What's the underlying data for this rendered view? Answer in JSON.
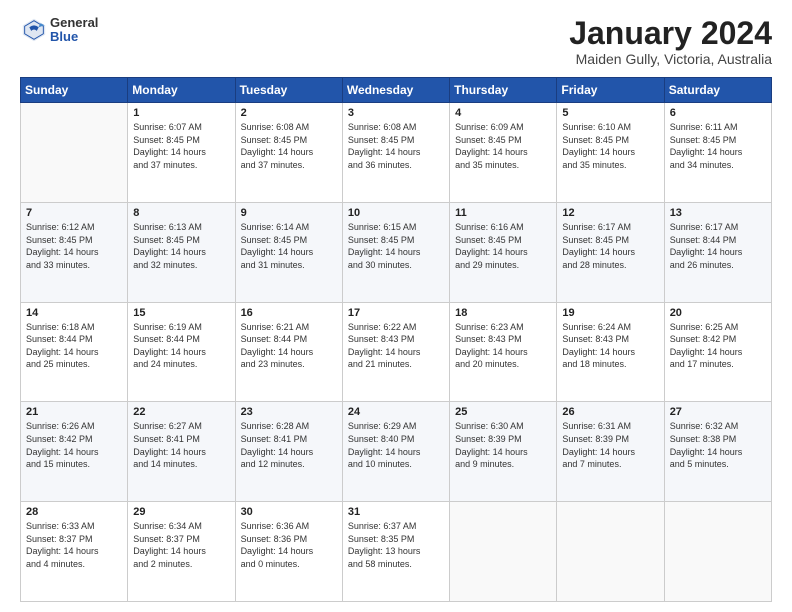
{
  "logo": {
    "general": "General",
    "blue": "Blue"
  },
  "header": {
    "title": "January 2024",
    "subtitle": "Maiden Gully, Victoria, Australia"
  },
  "days_of_week": [
    "Sunday",
    "Monday",
    "Tuesday",
    "Wednesday",
    "Thursday",
    "Friday",
    "Saturday"
  ],
  "weeks": [
    [
      {
        "day": "",
        "info": ""
      },
      {
        "day": "1",
        "info": "Sunrise: 6:07 AM\nSunset: 8:45 PM\nDaylight: 14 hours\nand 37 minutes."
      },
      {
        "day": "2",
        "info": "Sunrise: 6:08 AM\nSunset: 8:45 PM\nDaylight: 14 hours\nand 37 minutes."
      },
      {
        "day": "3",
        "info": "Sunrise: 6:08 AM\nSunset: 8:45 PM\nDaylight: 14 hours\nand 36 minutes."
      },
      {
        "day": "4",
        "info": "Sunrise: 6:09 AM\nSunset: 8:45 PM\nDaylight: 14 hours\nand 35 minutes."
      },
      {
        "day": "5",
        "info": "Sunrise: 6:10 AM\nSunset: 8:45 PM\nDaylight: 14 hours\nand 35 minutes."
      },
      {
        "day": "6",
        "info": "Sunrise: 6:11 AM\nSunset: 8:45 PM\nDaylight: 14 hours\nand 34 minutes."
      }
    ],
    [
      {
        "day": "7",
        "info": "Sunrise: 6:12 AM\nSunset: 8:45 PM\nDaylight: 14 hours\nand 33 minutes."
      },
      {
        "day": "8",
        "info": "Sunrise: 6:13 AM\nSunset: 8:45 PM\nDaylight: 14 hours\nand 32 minutes."
      },
      {
        "day": "9",
        "info": "Sunrise: 6:14 AM\nSunset: 8:45 PM\nDaylight: 14 hours\nand 31 minutes."
      },
      {
        "day": "10",
        "info": "Sunrise: 6:15 AM\nSunset: 8:45 PM\nDaylight: 14 hours\nand 30 minutes."
      },
      {
        "day": "11",
        "info": "Sunrise: 6:16 AM\nSunset: 8:45 PM\nDaylight: 14 hours\nand 29 minutes."
      },
      {
        "day": "12",
        "info": "Sunrise: 6:17 AM\nSunset: 8:45 PM\nDaylight: 14 hours\nand 28 minutes."
      },
      {
        "day": "13",
        "info": "Sunrise: 6:17 AM\nSunset: 8:44 PM\nDaylight: 14 hours\nand 26 minutes."
      }
    ],
    [
      {
        "day": "14",
        "info": "Sunrise: 6:18 AM\nSunset: 8:44 PM\nDaylight: 14 hours\nand 25 minutes."
      },
      {
        "day": "15",
        "info": "Sunrise: 6:19 AM\nSunset: 8:44 PM\nDaylight: 14 hours\nand 24 minutes."
      },
      {
        "day": "16",
        "info": "Sunrise: 6:21 AM\nSunset: 8:44 PM\nDaylight: 14 hours\nand 23 minutes."
      },
      {
        "day": "17",
        "info": "Sunrise: 6:22 AM\nSunset: 8:43 PM\nDaylight: 14 hours\nand 21 minutes."
      },
      {
        "day": "18",
        "info": "Sunrise: 6:23 AM\nSunset: 8:43 PM\nDaylight: 14 hours\nand 20 minutes."
      },
      {
        "day": "19",
        "info": "Sunrise: 6:24 AM\nSunset: 8:43 PM\nDaylight: 14 hours\nand 18 minutes."
      },
      {
        "day": "20",
        "info": "Sunrise: 6:25 AM\nSunset: 8:42 PM\nDaylight: 14 hours\nand 17 minutes."
      }
    ],
    [
      {
        "day": "21",
        "info": "Sunrise: 6:26 AM\nSunset: 8:42 PM\nDaylight: 14 hours\nand 15 minutes."
      },
      {
        "day": "22",
        "info": "Sunrise: 6:27 AM\nSunset: 8:41 PM\nDaylight: 14 hours\nand 14 minutes."
      },
      {
        "day": "23",
        "info": "Sunrise: 6:28 AM\nSunset: 8:41 PM\nDaylight: 14 hours\nand 12 minutes."
      },
      {
        "day": "24",
        "info": "Sunrise: 6:29 AM\nSunset: 8:40 PM\nDaylight: 14 hours\nand 10 minutes."
      },
      {
        "day": "25",
        "info": "Sunrise: 6:30 AM\nSunset: 8:39 PM\nDaylight: 14 hours\nand 9 minutes."
      },
      {
        "day": "26",
        "info": "Sunrise: 6:31 AM\nSunset: 8:39 PM\nDaylight: 14 hours\nand 7 minutes."
      },
      {
        "day": "27",
        "info": "Sunrise: 6:32 AM\nSunset: 8:38 PM\nDaylight: 14 hours\nand 5 minutes."
      }
    ],
    [
      {
        "day": "28",
        "info": "Sunrise: 6:33 AM\nSunset: 8:37 PM\nDaylight: 14 hours\nand 4 minutes."
      },
      {
        "day": "29",
        "info": "Sunrise: 6:34 AM\nSunset: 8:37 PM\nDaylight: 14 hours\nand 2 minutes."
      },
      {
        "day": "30",
        "info": "Sunrise: 6:36 AM\nSunset: 8:36 PM\nDaylight: 14 hours\nand 0 minutes."
      },
      {
        "day": "31",
        "info": "Sunrise: 6:37 AM\nSunset: 8:35 PM\nDaylight: 13 hours\nand 58 minutes."
      },
      {
        "day": "",
        "info": ""
      },
      {
        "day": "",
        "info": ""
      },
      {
        "day": "",
        "info": ""
      }
    ]
  ]
}
